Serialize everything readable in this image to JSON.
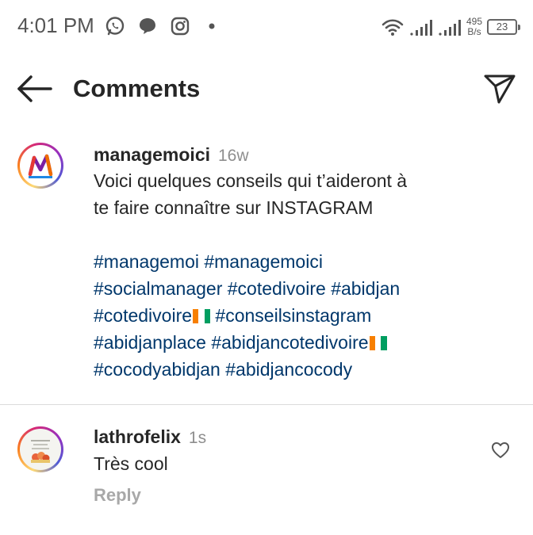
{
  "status_bar": {
    "time": "4:01 PM",
    "net_speed_value": "495",
    "net_speed_unit": "B/s",
    "battery": "23",
    "icons": [
      "whatsapp-icon",
      "chat-bubble-icon",
      "instagram-icon",
      "dot-icon",
      "wifi-icon",
      "signal-icon",
      "signal-icon"
    ]
  },
  "header": {
    "title": "Comments",
    "icons": [
      "back-arrow-icon",
      "send-icon"
    ]
  },
  "caption": {
    "username": "managemoici",
    "time": "16w",
    "text_lines": [
      "Voici quelques conseils qui t’aideront à",
      "te faire connaître sur INSTAGRAM"
    ],
    "hashtag_lines": [
      [
        "#managemoi",
        "#managemoici"
      ],
      [
        "#socialmanager",
        "#cotedivoire",
        "#abidjan"
      ],
      [
        "#cotedivoire",
        "#conseilsinstagram"
      ],
      [
        "#abidjanplace",
        "#abidjancotedivoire"
      ],
      [
        "#cocodyabidjan",
        "#abidjancocody"
      ]
    ]
  },
  "comment": {
    "username": "lathrofelix",
    "time": "1s",
    "text": "Très cool",
    "reply_label": "Reply",
    "icons": [
      "heart-icon"
    ]
  },
  "colors": {
    "hashtag": "#00376b",
    "secondary_text": "#8e8e8e",
    "reply": "#a8a8a8",
    "flag_orange": "#f77f00",
    "flag_green": "#009e60"
  }
}
